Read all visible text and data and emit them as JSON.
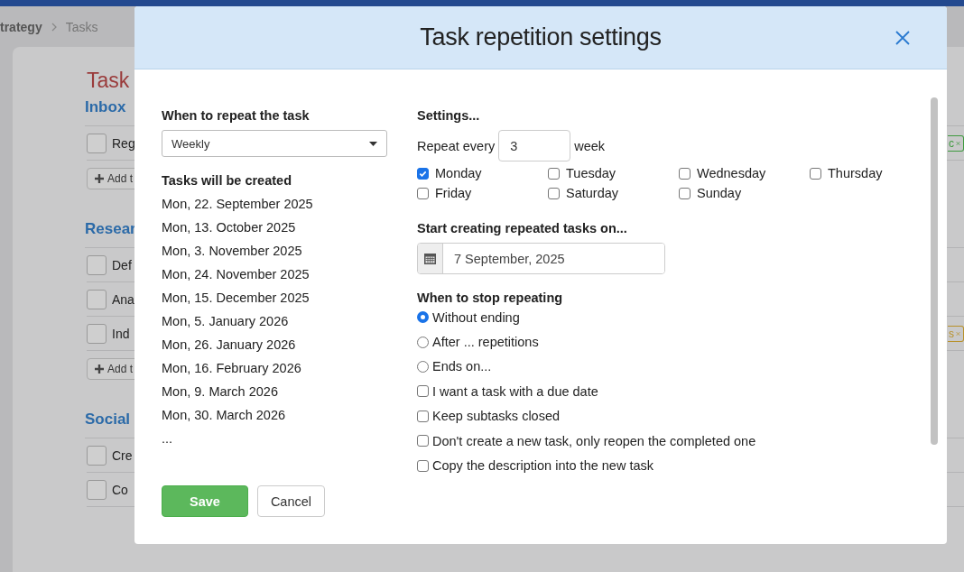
{
  "background": {
    "breadcrumb": [
      "trategy",
      "Tasks"
    ],
    "title": "Task",
    "sections": [
      {
        "name": "Inbox",
        "tasks": [
          {
            "label": "Reg",
            "checked": false,
            "tag": {
              "label": "c",
              "color": "#3f9a3f"
            }
          }
        ],
        "add_label": "Add t"
      },
      {
        "name": "Resear",
        "tasks": [
          {
            "label": "Def",
            "checked": false
          },
          {
            "label": "Ana",
            "checked": false
          },
          {
            "label": "Ind",
            "checked": false,
            "tag": {
              "label": "s",
              "color": "#b8912a"
            }
          }
        ],
        "add_label": "Add t"
      },
      {
        "name": "Social",
        "tasks": [
          {
            "label": "Cre",
            "checked": false
          },
          {
            "label": "Co",
            "checked": false
          }
        ]
      }
    ]
  },
  "dialog": {
    "title": "Task repetition settings",
    "repeat_label": "When to repeat the task",
    "repeat_value": "Weekly",
    "created_label": "Tasks will be created",
    "dates": [
      "Mon, 22. September 2025",
      "Mon, 13. October 2025",
      "Mon, 3. November 2025",
      "Mon, 24. November 2025",
      "Mon, 15. December 2025",
      "Mon, 5. January 2026",
      "Mon, 26. January 2026",
      "Mon, 16. February 2026",
      "Mon, 9. March 2026",
      "Mon, 30. March 2026",
      "..."
    ],
    "settings_label": "Settings...",
    "repeat_every": "Repeat every",
    "interval": "3",
    "unit": "week",
    "days": [
      {
        "label": "Monday",
        "checked": true
      },
      {
        "label": "Tuesday",
        "checked": false
      },
      {
        "label": "Wednesday",
        "checked": false
      },
      {
        "label": "Thursday",
        "checked": false
      },
      {
        "label": "Friday",
        "checked": false
      },
      {
        "label": "Saturday",
        "checked": false
      },
      {
        "label": "Sunday",
        "checked": false
      }
    ],
    "start_label": "Start creating repeated tasks on...",
    "start_date": "7 September, 2025",
    "stop_label": "When to stop repeating",
    "stop_options": [
      {
        "label": "Without ending",
        "selected": true
      },
      {
        "label": "After ... repetitions",
        "selected": false
      },
      {
        "label": "Ends on...",
        "selected": false
      }
    ],
    "options": [
      {
        "label": "I want a task with a due date",
        "checked": false
      },
      {
        "label": "Keep subtasks closed",
        "checked": false
      },
      {
        "label": "Don't create a new task, only reopen the completed one",
        "checked": false
      },
      {
        "label": "Copy the description into the new task",
        "checked": false
      }
    ],
    "buttons": [
      {
        "label": "Save",
        "kind": "primary"
      },
      {
        "label": "Cancel",
        "kind": "secondary"
      }
    ]
  }
}
